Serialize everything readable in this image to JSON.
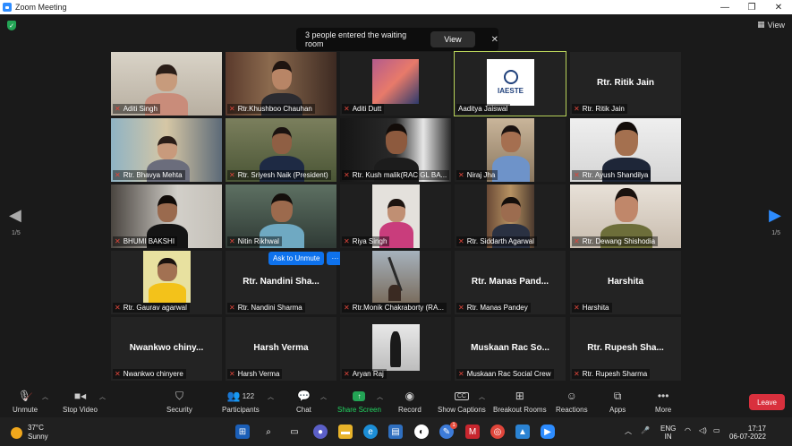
{
  "window": {
    "title": "Zoom Meeting",
    "minimize": "—",
    "maximize": "❐",
    "close": "✕"
  },
  "top": {
    "view_label": "View"
  },
  "notification": {
    "text": "3 people entered the waiting room",
    "view_button": "View",
    "close": "✕"
  },
  "pagination": {
    "left": "1/5",
    "right": "1/5"
  },
  "tiles": [
    {
      "name": "Aditi Singh"
    },
    {
      "name": "Rtr.Khushboo Chauhan"
    },
    {
      "name": "Aditi Dutt"
    },
    {
      "name": "Aaditya Jaiswal",
      "logo": "IAESTE"
    },
    {
      "name": "Rtr. Ritik Jain",
      "display": "Rtr. Ritik Jain"
    },
    {
      "name": "Rtr. Bhavya Mehta"
    },
    {
      "name": "Rtr. Sriyesh Naik (President)"
    },
    {
      "name": "Rtr. Kush malik(RAC GL BA..."
    },
    {
      "name": "Niraj Jha"
    },
    {
      "name": "Rtr. Ayush Shandilya"
    },
    {
      "name": "BHUMI BAKSHI"
    },
    {
      "name": "Nitin Rikhwal"
    },
    {
      "name": "Riya Singh"
    },
    {
      "name": "Rtr. Siddarth Agarwal"
    },
    {
      "name": "Rtr. Dewang Shishodia"
    },
    {
      "name": "Rtr. Gaurav agarwal"
    },
    {
      "name": "Rtr. Nandini Sharma",
      "display": "Rtr. Nandini Sha..."
    },
    {
      "name": "Rtr.Monik Chakraborty (RA..."
    },
    {
      "name": "Rtr. Manas Pandey",
      "display": "Rtr. Manas Pand..."
    },
    {
      "name": "Harshita",
      "display": "Harshita"
    },
    {
      "name": "Nwankwo chinyere",
      "display": "Nwankwo chiny..."
    },
    {
      "name": "Harsh Verma",
      "display": "Harsh Verma"
    },
    {
      "name": "Aryan Raj"
    },
    {
      "name": "Muskaan Rac Social Crew",
      "display": "Muskaan Rac So..."
    },
    {
      "name": "Rtr. Rupesh Sharma",
      "display": "Rtr. Rupesh Sha..."
    }
  ],
  "overlay": {
    "ask_unmute": "Ask to Unmute",
    "more": "···"
  },
  "toolbar": {
    "unmute": "Unmute",
    "stop_video": "Stop Video",
    "security": "Security",
    "participants": "Participants",
    "participants_count": "122",
    "chat": "Chat",
    "share_screen": "Share Screen",
    "record": "Record",
    "show_captions": "Show Captions",
    "breakout_rooms": "Breakout Rooms",
    "reactions": "Reactions",
    "apps": "Apps",
    "more": "More",
    "leave": "Leave"
  },
  "taskbar": {
    "temperature": "37°C",
    "weather": "Sunny",
    "lang1": "ENG",
    "lang2": "IN",
    "time": "17:17",
    "date": "06-07-2022",
    "badge": "1"
  }
}
